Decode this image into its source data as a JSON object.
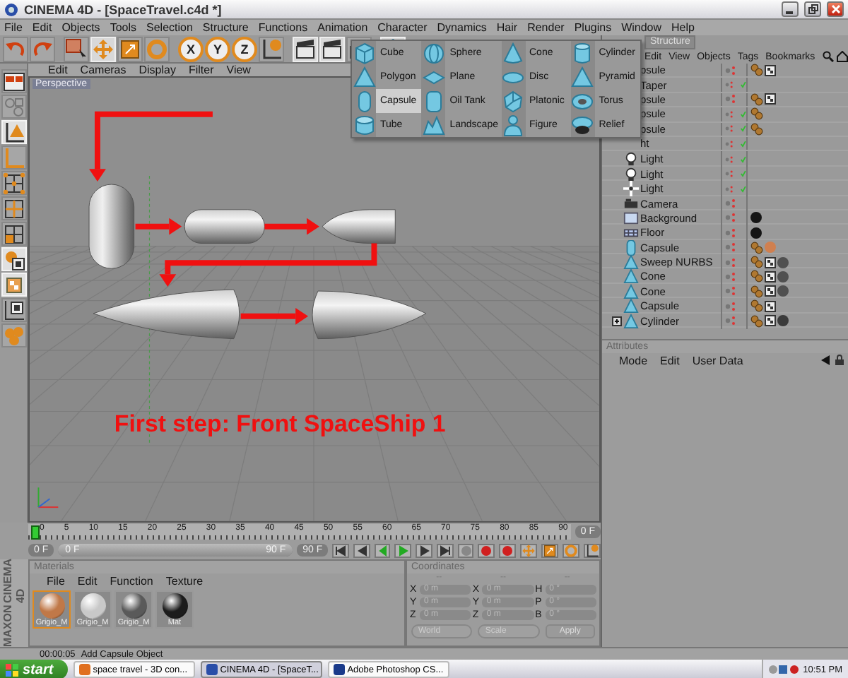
{
  "window": {
    "title": "CINEMA 4D - [SpaceTravel.c4d *]"
  },
  "menu": [
    "File",
    "Edit",
    "Objects",
    "Tools",
    "Selection",
    "Structure",
    "Functions",
    "Animation",
    "Character",
    "Dynamics",
    "Hair",
    "Render",
    "Plugins",
    "Window",
    "Help"
  ],
  "toolbar": [
    {
      "kind": "undo",
      "selected": false
    },
    {
      "kind": "redo",
      "selected": false
    },
    {
      "kind": "select",
      "selected": false
    },
    {
      "kind": "move",
      "selected": true
    },
    {
      "kind": "scale",
      "selected": false
    },
    {
      "kind": "rotate",
      "selected": false
    },
    {
      "kind": "axis",
      "label": "X",
      "selected": false
    },
    {
      "kind": "axis",
      "label": "Y",
      "selected": false
    },
    {
      "kind": "axis",
      "label": "Z",
      "selected": false
    },
    {
      "kind": "coords",
      "selected": false
    },
    {
      "kind": "clapper",
      "selected": true
    },
    {
      "kind": "clapper",
      "selected": true
    },
    {
      "kind": "clapper",
      "selected": false
    },
    {
      "kind": "cube",
      "selected": true
    }
  ],
  "left_tools": [
    {
      "kind": "layout",
      "selected": false
    },
    {
      "kind": "mesh",
      "selected": false
    },
    {
      "kind": "model",
      "selected": true
    },
    {
      "kind": "axes",
      "selected": false
    },
    {
      "kind": "points",
      "selected": false
    },
    {
      "kind": "edges",
      "selected": false
    },
    {
      "kind": "polygons",
      "selected": false
    },
    {
      "kind": "texture",
      "selected": true
    },
    {
      "kind": "checker",
      "selected": true
    },
    {
      "kind": "uv",
      "selected": false
    },
    {
      "kind": "group",
      "selected": false
    }
  ],
  "viewport": {
    "menu": [
      "Edit",
      "Cameras",
      "Display",
      "Filter",
      "View"
    ],
    "label": "Perspective",
    "caption": "First step: Front SpaceShip 1"
  },
  "create_menu": {
    "items": [
      {
        "label": "Cube",
        "kind": "cube",
        "selected": false
      },
      {
        "label": "Sphere",
        "kind": "sphere",
        "selected": false
      },
      {
        "label": "Cone",
        "kind": "cone",
        "selected": false
      },
      {
        "label": "Cylinder",
        "kind": "cylinder",
        "selected": false
      },
      {
        "label": "Polygon",
        "kind": "polygon",
        "selected": false
      },
      {
        "label": "Plane",
        "kind": "plane",
        "selected": false
      },
      {
        "label": "Disc",
        "kind": "disc",
        "selected": false
      },
      {
        "label": "Pyramid",
        "kind": "pyramid",
        "selected": false
      },
      {
        "label": "Capsule",
        "kind": "capsule",
        "selected": true
      },
      {
        "label": "Oil Tank",
        "kind": "oiltank",
        "selected": false
      },
      {
        "label": "Platonic",
        "kind": "platonic",
        "selected": false
      },
      {
        "label": "Torus",
        "kind": "torus",
        "selected": false
      },
      {
        "label": "Tube",
        "kind": "tube",
        "selected": false
      },
      {
        "label": "Landscape",
        "kind": "landscape",
        "selected": false
      },
      {
        "label": "Figure",
        "kind": "figure",
        "selected": false
      },
      {
        "label": "Relief",
        "kind": "relief",
        "selected": false
      }
    ]
  },
  "objects": {
    "tabs": [
      {
        "label": "Structure",
        "selected": false
      }
    ],
    "menu": [
      "Edit",
      "View",
      "Objects",
      "Tags",
      "Bookmarks"
    ],
    "rows": [
      {
        "name": "psule",
        "active": false,
        "collapsed": false,
        "tags": [
          {
            "kind": "phong"
          },
          {
            "kind": "texture"
          }
        ]
      },
      {
        "name": "Taper",
        "active": true,
        "collapsed": false,
        "tags": []
      },
      {
        "name": "psule",
        "active": false,
        "collapsed": false,
        "tags": [
          {
            "kind": "phong"
          },
          {
            "kind": "texture"
          }
        ]
      },
      {
        "name": "psule",
        "active": true,
        "collapsed": false,
        "tags": [
          {
            "kind": "phong"
          }
        ]
      },
      {
        "name": "psule",
        "active": true,
        "collapsed": false,
        "tags": [
          {
            "kind": "phong"
          }
        ]
      },
      {
        "name": "ht",
        "active": true,
        "collapsed": false,
        "tags": []
      },
      {
        "name": "Light",
        "kind": "light",
        "active": true,
        "collapsed": false,
        "tags": []
      },
      {
        "name": "Light",
        "kind": "light",
        "active": true,
        "collapsed": false,
        "tags": []
      },
      {
        "name": "Light",
        "kind": "omni",
        "active": true,
        "collapsed": false,
        "tags": []
      },
      {
        "name": "Camera",
        "kind": "camera",
        "active": false,
        "collapsed": false,
        "tags": []
      },
      {
        "name": "Background",
        "kind": "background",
        "active": false,
        "collapsed": false,
        "tags": [
          {
            "kind": "material",
            "color": "#151515"
          }
        ]
      },
      {
        "name": "Floor",
        "kind": "floor",
        "active": false,
        "collapsed": false,
        "tags": [
          {
            "kind": "material",
            "color": "#151515"
          }
        ]
      },
      {
        "name": "Capsule",
        "kind": "capsule",
        "active": false,
        "collapsed": false,
        "tags": [
          {
            "kind": "phong"
          },
          {
            "kind": "material",
            "color": "#d08050"
          }
        ]
      },
      {
        "name": "Sweep NURBS",
        "kind": "polygon",
        "active": false,
        "collapsed": false,
        "tags": [
          {
            "kind": "phong"
          },
          {
            "kind": "texture"
          },
          {
            "kind": "material",
            "color": "#505050"
          }
        ]
      },
      {
        "name": "Cone",
        "kind": "polygon",
        "active": false,
        "collapsed": false,
        "tags": [
          {
            "kind": "phong"
          },
          {
            "kind": "texture"
          },
          {
            "kind": "material",
            "color": "#505050"
          }
        ]
      },
      {
        "name": "Cone",
        "kind": "polygon",
        "active": false,
        "collapsed": false,
        "tags": [
          {
            "kind": "phong"
          },
          {
            "kind": "texture"
          },
          {
            "kind": "material",
            "color": "#505050"
          }
        ]
      },
      {
        "name": "Capsule",
        "kind": "polygon",
        "active": false,
        "collapsed": false,
        "tags": [
          {
            "kind": "phong"
          },
          {
            "kind": "texture"
          }
        ]
      },
      {
        "name": "Cylinder",
        "kind": "polygon",
        "active": false,
        "collapsed": true,
        "tags": [
          {
            "kind": "phong"
          },
          {
            "kind": "texture"
          },
          {
            "kind": "material",
            "color": "#3a3a3a"
          }
        ]
      }
    ]
  },
  "attributes": {
    "title": "Attributes",
    "menu": [
      "Mode",
      "Edit",
      "User Data"
    ]
  },
  "timeline": {
    "ruler": [
      "0",
      "5",
      "10",
      "15",
      "20",
      "25",
      "30",
      "35",
      "40",
      "45",
      "50",
      "55",
      "60",
      "65",
      "70",
      "75",
      "80",
      "85",
      "90"
    ],
    "current": "0 F",
    "level": 1,
    "start": "0 F",
    "range_start": "0 F",
    "range_end": "90 F",
    "end": "90 F"
  },
  "materials": {
    "title": "Materials",
    "menu": [
      "File",
      "Edit",
      "Function",
      "Texture"
    ],
    "items": [
      {
        "name": "Grigio_M",
        "color": "#c07848",
        "selected": true
      },
      {
        "name": "Grigio_M",
        "color": "#c8c8c8",
        "selected": false
      },
      {
        "name": "Grigio_M",
        "color": "#5a5a5a",
        "selected": false
      },
      {
        "name": "Mat",
        "color": "#1c1c1c",
        "selected": false
      }
    ]
  },
  "coordinates": {
    "title": "Coordinates",
    "columns": [
      "--",
      "--",
      "--"
    ],
    "rows": [
      {
        "a": "X",
        "a_value": "0 m",
        "b": "X",
        "b_value": "0 m",
        "c": "H",
        "c_value": "0 °"
      },
      {
        "a": "Y",
        "a_value": "0 m",
        "b": "Y",
        "b_value": "0 m",
        "c": "P",
        "c_value": "0 °"
      },
      {
        "a": "Z",
        "a_value": "0 m",
        "b": "Z",
        "b_value": "0 m",
        "c": "B",
        "c_value": "0 °"
      }
    ],
    "mode": "World",
    "transform": "Scale",
    "apply": "Apply"
  },
  "logo": {
    "brand": "MAXON",
    "product": "CINEMA 4D"
  },
  "status": {
    "time": "00:00:05",
    "message": "Add Capsule Object"
  },
  "taskbar": {
    "start": "start",
    "tasks": [
      {
        "label": "space travel - 3D con...",
        "selected": false
      },
      {
        "label": "CINEMA 4D - [SpaceT...",
        "selected": true
      },
      {
        "label": "Adobe Photoshop CS...",
        "selected": false
      }
    ],
    "clock": "10:51 PM"
  }
}
